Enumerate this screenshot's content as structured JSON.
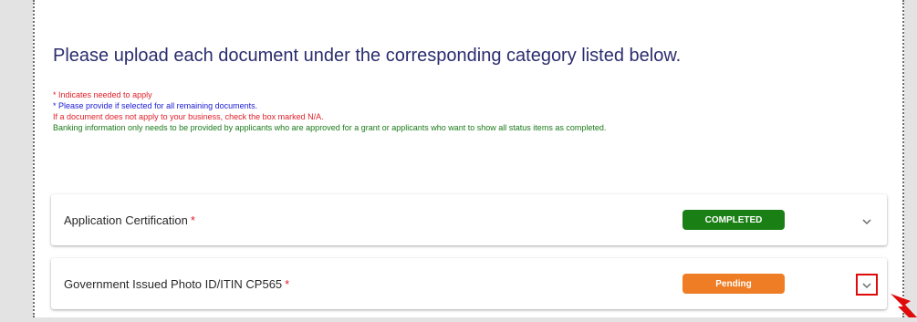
{
  "instructions": {
    "heading": "Please upload each document under the corresponding category listed below.",
    "notes": [
      "* Indicates needed to apply",
      "* Please provide if selected for all remaining documents.",
      "If a document does not apply to your business, check the box marked N/A.",
      "Banking information only needs to be provided by applicants who are approved for a grant or applicants who want to show all status items as completed."
    ]
  },
  "documents": [
    {
      "title": "Application Certification",
      "required_marker": "*",
      "status": "COMPLETED",
      "status_color": "#1a7f14",
      "expand_icon": "chevron-down-icon"
    },
    {
      "title": "Government Issued Photo ID/ITIN CP565",
      "required_marker": "*",
      "status": "Pending",
      "status_color": "#ee7d25",
      "expand_icon": "chevron-down-icon",
      "highlighted": true
    }
  ],
  "annotation": {
    "highlight_color": "#e10a0a",
    "pointer": "red-arrow-icon"
  }
}
